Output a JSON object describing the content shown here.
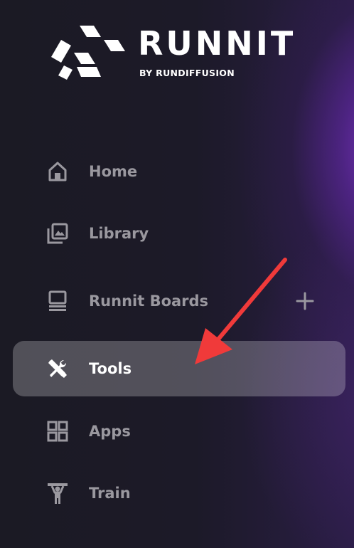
{
  "brand": {
    "wordmark": "RUNNIT",
    "subtitle": "BY RUNDIFFUSION"
  },
  "nav": {
    "items": [
      {
        "label": "Home",
        "icon": "home-icon",
        "active": false
      },
      {
        "label": "Library",
        "icon": "library-icon",
        "active": false
      },
      {
        "label": "Runnit Boards",
        "icon": "boards-icon",
        "active": false
      },
      {
        "label": "Tools",
        "icon": "tools-icon",
        "active": true
      },
      {
        "label": "Apps",
        "icon": "apps-icon",
        "active": false
      },
      {
        "label": "Train",
        "icon": "train-icon",
        "active": false
      }
    ],
    "add_icon": "plus-icon"
  },
  "colors": {
    "background": "#1b1a24",
    "accent_purple": "#8636d2",
    "inactive_text": "#9a989f",
    "active_text": "#ffffff",
    "annotation_arrow": "#f03a3a"
  }
}
